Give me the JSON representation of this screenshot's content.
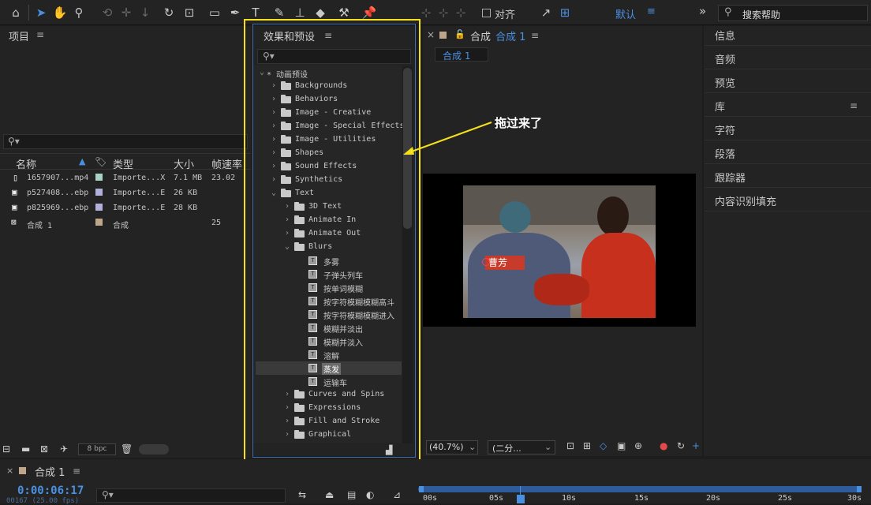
{
  "toolbar": {
    "snap_label": "对齐",
    "workspace": "默认",
    "more": "»",
    "search_placeholder": "搜索帮助"
  },
  "project": {
    "title": "项目",
    "columns": {
      "name": "名称",
      "type": "类型",
      "size": "大小",
      "fps": "帧速率"
    },
    "rows": [
      {
        "name": "1657907...mp4",
        "type": "Importe...X",
        "size": "7.1 MB",
        "fps": "23.02",
        "icon": "video-file-icon",
        "color": "#a8d1c8"
      },
      {
        "name": "p527408...ebp",
        "type": "Importe...E",
        "size": "26 KB",
        "fps": "",
        "icon": "image-file-icon",
        "color": "#b0b0d8"
      },
      {
        "name": "p825969...ebp",
        "type": "Importe...E",
        "size": "28 KB",
        "fps": "",
        "icon": "image-file-icon",
        "color": "#b0b0d8"
      },
      {
        "name": "合成 1",
        "type": "合成",
        "size": "",
        "fps": "25",
        "icon": "composition-icon",
        "color": "#bfa58a"
      }
    ],
    "bpc": "8 bpc"
  },
  "effects": {
    "title": "效果和预设",
    "root": "* 动画预设",
    "items": [
      "Backgrounds",
      "Behaviors",
      "Image - Creative",
      "Image - Special Effects",
      "Image - Utilities",
      "Shapes",
      "Sound Effects",
      "Synthetics",
      "Text",
      "3D Text",
      "Animate In",
      "Animate Out",
      "Blurs",
      "多雾",
      "子弹头列车",
      "按单词模糊",
      "按字符模糊模糊高斗",
      "按字符模糊模糊进入",
      "模糊并淡出",
      "模糊并淡入",
      "溶解",
      "蒸发",
      "运输车",
      "Curves and Spins",
      "Expressions",
      "Fill and Stroke",
      "Graphical"
    ]
  },
  "composition": {
    "tab_label": "合成",
    "tab_name": "合成 1",
    "subtab": "合成 1",
    "zoom": "(40.7%)",
    "resolution": "(二分...",
    "video_caption": "曹芳"
  },
  "annotation": {
    "text": "拖过来了"
  },
  "right_panel": {
    "items": [
      "信息",
      "音频",
      "预览",
      "库",
      "字符",
      "段落",
      "跟踪器",
      "内容识别填充"
    ]
  },
  "timeline": {
    "tab": "合成 1",
    "timecode": "0:00:06:17",
    "frames": "00167 (25.00 fps)",
    "ruler": [
      "00s",
      "05s",
      "10s",
      "15s",
      "20s",
      "25s",
      "30s"
    ]
  }
}
